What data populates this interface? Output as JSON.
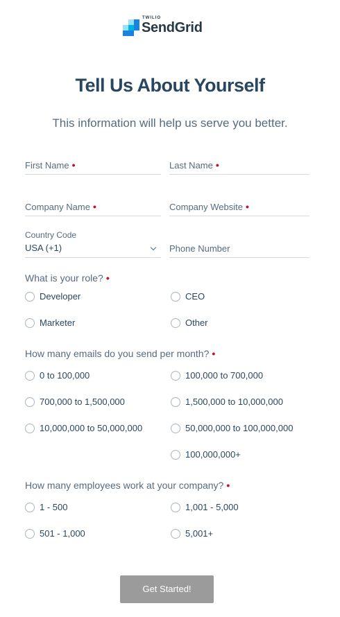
{
  "logo": {
    "small": "TWILIO",
    "name": "SendGrid"
  },
  "page": {
    "title": "Tell Us About Yourself",
    "subtitle": "This information will help us serve you better."
  },
  "fields": {
    "first_name": "First Name",
    "last_name": "Last Name",
    "company_name": "Company Name",
    "company_website": "Company Website",
    "country_code_label": "Country Code",
    "country_code_value": "USA (+1)",
    "phone_number": "Phone Number",
    "required_mark": "•"
  },
  "questions": {
    "role": {
      "label": "What is your role?",
      "options": [
        "Developer",
        "CEO",
        "Marketer",
        "Other"
      ]
    },
    "emails": {
      "label": "How many emails do you send per month?",
      "options": [
        "0 to 100,000",
        "100,000 to 700,000",
        "700,000 to 1,500,000",
        "1,500,000 to 10,000,000",
        "10,000,000 to 50,000,000",
        "50,000,000 to 100,000,000",
        "100,000,000+"
      ]
    },
    "employees": {
      "label": "How many employees work at your company?",
      "options": [
        "1 - 500",
        "1,001 - 5,000",
        "501 - 1,000",
        "5,001+"
      ]
    }
  },
  "submit": {
    "label": "Get Started!"
  },
  "colors": {
    "brand_dark": "#294661",
    "required": "#c0112d",
    "button_disabled": "#9b9b9b",
    "logo_blue": "#1a82e2"
  }
}
